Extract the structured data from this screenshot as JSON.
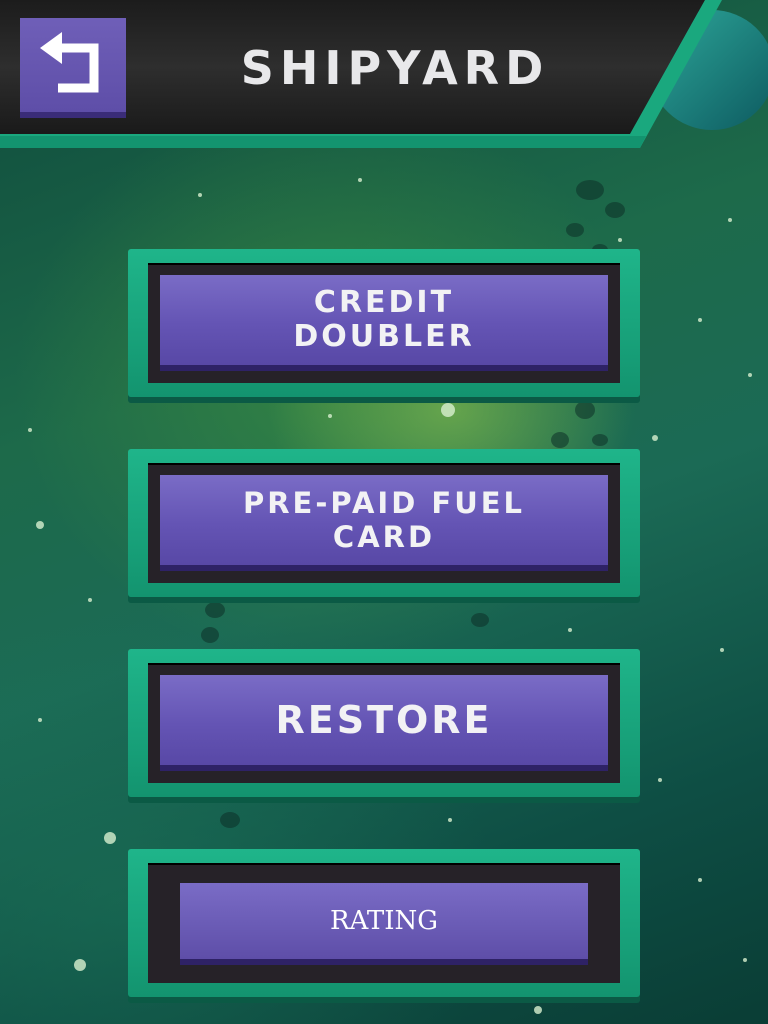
{
  "header": {
    "title": "SHIPYARD",
    "back_icon": "return-arrow-icon"
  },
  "menu": [
    {
      "id": "credit-doubler",
      "lines": [
        "CREDIT",
        "DOUBLER"
      ]
    },
    {
      "id": "prepaid-fuel-card",
      "lines": [
        "PRE-PAID FUEL",
        "CARD"
      ]
    },
    {
      "id": "restore",
      "lines": [
        "RESTORE"
      ]
    },
    {
      "id": "rating",
      "label": "RATING"
    }
  ],
  "colors": {
    "header_bar": "#262626",
    "accent_teal": "#1fb58a",
    "button_purple": "#6454b4",
    "background_green": "#1d6a4a"
  }
}
